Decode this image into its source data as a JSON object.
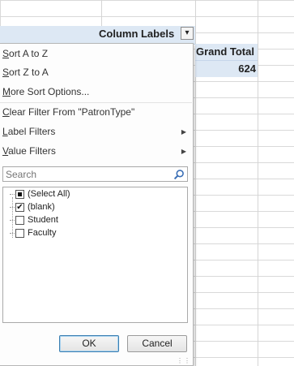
{
  "pivot": {
    "column_labels": "Column Labels",
    "filter_icon": "filter-dropdown-icon",
    "grand_total_label": "Grand Total",
    "grand_total_value": "624"
  },
  "menu": {
    "sort_az": {
      "underline": "S",
      "rest": "ort A to Z"
    },
    "sort_za": {
      "underline": "S",
      "rest": "ort Z to A"
    },
    "more_sort": {
      "underline": "M",
      "rest": "ore Sort Options..."
    },
    "clear_filter": {
      "underline": "C",
      "rest": "lear Filter From \"PatronType\""
    },
    "label_filters": {
      "underline": "L",
      "rest": "abel Filters"
    },
    "value_filters": {
      "underline": "V",
      "rest": "alue Filters"
    }
  },
  "search": {
    "placeholder": "Search"
  },
  "list": [
    {
      "label": "(Select All)",
      "state": "partial"
    },
    {
      "label": "(blank)",
      "state": "checked"
    },
    {
      "label": "Student",
      "state": "unchecked"
    },
    {
      "label": "Faculty",
      "state": "unchecked"
    }
  ],
  "buttons": {
    "ok": "OK",
    "cancel": "Cancel"
  },
  "colors": {
    "header_fill": "#dde8f4",
    "ok_border": "#3c7fb1"
  }
}
